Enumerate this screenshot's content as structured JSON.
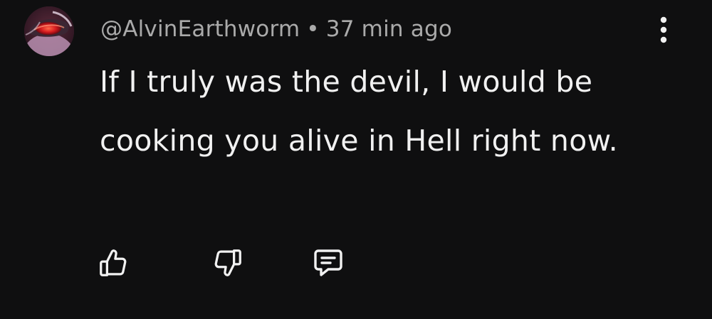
{
  "comment": {
    "author": "@AlvinEarthworm",
    "separator": "•",
    "timestamp": "37 min ago",
    "text": "If I truly was the devil, I would be cooking you alive in Hell right now."
  },
  "icons": {
    "avatar": "avatar-image",
    "more": "more-vertical-icon",
    "like": "thumbs-up-icon",
    "dislike": "thumbs-down-icon",
    "reply": "reply-comment-icon"
  },
  "colors": {
    "background": "#0f0f10",
    "meta_text": "#aaaaaa",
    "body_text": "#f1f1f1",
    "icon": "#f1f1f1"
  }
}
